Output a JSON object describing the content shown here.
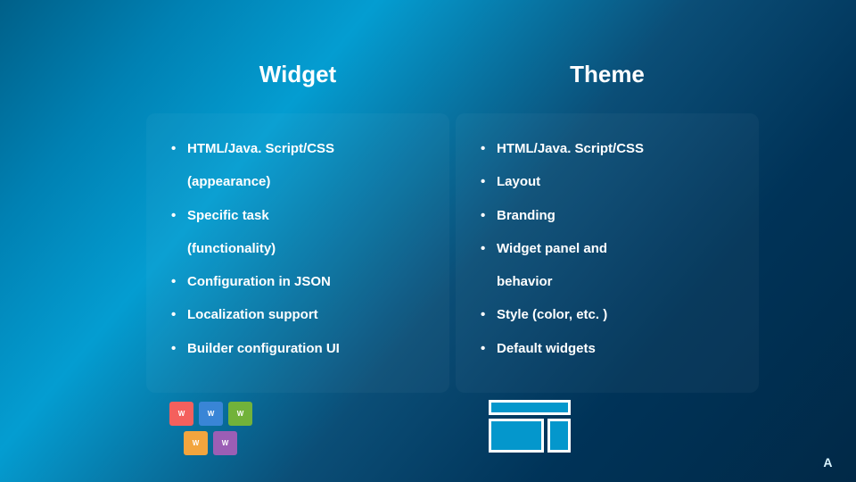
{
  "columns": {
    "widget": {
      "title": "Widget",
      "items": [
        {
          "text": "HTML/Java. Script/CSS",
          "bulleted": true
        },
        {
          "text": "(appearance)",
          "bulleted": false
        },
        {
          "text": "Specific task",
          "bulleted": true
        },
        {
          "text": "(functionality)",
          "bulleted": false
        },
        {
          "text": "Configuration in JSON",
          "bulleted": true
        },
        {
          "text": "Localization support",
          "bulleted": true
        },
        {
          "text": "Builder configuration UI",
          "bulleted": true
        }
      ]
    },
    "theme": {
      "title": "Theme",
      "items": [
        {
          "text": "HTML/Java. Script/CSS",
          "bulleted": true
        },
        {
          "text": "Layout",
          "bulleted": true
        },
        {
          "text": "Branding",
          "bulleted": true
        },
        {
          "text": "Widget panel and",
          "bulleted": true
        },
        {
          "text": "behavior",
          "bulleted": false
        },
        {
          "text": "Style (color, etc. )",
          "bulleted": true
        },
        {
          "text": "Default widgets",
          "bulleted": true
        }
      ]
    }
  },
  "tiles": {
    "label": "W"
  },
  "brand": "A"
}
